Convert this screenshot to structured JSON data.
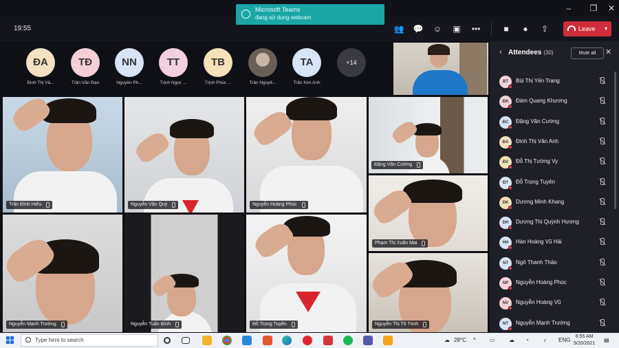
{
  "toast": {
    "title": "Microsoft Teams",
    "subtitle": "đang sử dụng webcam"
  },
  "meeting": {
    "time": "19:55",
    "leave_label": "Leave"
  },
  "avatar_row": [
    {
      "initials": "ĐA",
      "name": "Đinh Thị Vâ...",
      "color": "#f3e1c2"
    },
    {
      "initials": "TĐ",
      "name": "Trần Văn Đạo",
      "color": "#f4cfd6"
    },
    {
      "initials": "NN",
      "name": "Nguyễn Ph...",
      "color": "#d8e3f3"
    },
    {
      "initials": "TT",
      "name": "Trịnh Ngọc ...",
      "color": "#f4cfe0"
    },
    {
      "initials": "TB",
      "name": "Trịnh Phúc ...",
      "color": "#f4e2b8"
    },
    {
      "initials": "",
      "name": "Trần Nguyê...",
      "color": "#7a6f6a"
    },
    {
      "initials": "TA",
      "name": "Trần Kim Anh",
      "color": "#d6e4f5"
    }
  ],
  "more_count": "+14",
  "video_tiles": [
    {
      "name": "Trần Đình Hiếu"
    },
    {
      "name": "Nguyễn Văn Quý"
    },
    {
      "name": "Nguyễn Hoàng Phúc"
    },
    {
      "name": "Đặng Văn Cường"
    },
    {
      "name": "Phạm Thị Xuân Mai"
    },
    {
      "name": "Nguyễn Mạnh Trường"
    },
    {
      "name": "Nguyễn Tuấn Bình"
    },
    {
      "name": "Đỗ Trọng Tuyên"
    },
    {
      "name": "Nguyễn Thị Tô Trinh"
    }
  ],
  "attendees": {
    "title": "Attendees",
    "count": "(30)",
    "mute_all_label": "Mute all",
    "list": [
      {
        "initials": "BT",
        "name": "Bùi Thị Yến Trang",
        "color": "#f4d4dc"
      },
      {
        "initials": "ĐK",
        "name": "Đàm Quang Khương",
        "color": "#f4d0d8"
      },
      {
        "initials": "ĐC",
        "name": "Đặng Văn Cường",
        "color": "#d6e2f4"
      },
      {
        "initials": "ĐA",
        "name": "Đinh Thị Vân Anh",
        "color": "#f3e0c0"
      },
      {
        "initials": "ĐV",
        "name": "Đỗ Thị Tường Vy",
        "color": "#f1e3b4"
      },
      {
        "initials": "ĐT",
        "name": "Đỗ Trọng Tuyên",
        "color": "#d8e4f4"
      },
      {
        "initials": "DK",
        "name": "Dương Minh Khang",
        "color": "#f3dfb6"
      },
      {
        "initials": "DH",
        "name": "Dương Thị Quỳnh Hương",
        "color": "#d6e2f4"
      },
      {
        "initials": "HH",
        "name": "Hán Hoàng Vũ Hải",
        "color": "#d8e3f3"
      },
      {
        "initials": "NT",
        "name": "Ngô Thanh Thảo",
        "color": "#d8e3f3"
      },
      {
        "initials": "NP",
        "name": "Nguyễn Hoàng Phúc",
        "color": "#f4d4dc"
      },
      {
        "initials": "NV",
        "name": "Nguyễn Hoàng Vũ",
        "color": "#f4d0d8"
      },
      {
        "initials": "NT",
        "name": "Nguyễn Mạnh Trường",
        "color": "#d8e3f3"
      }
    ]
  },
  "taskbar": {
    "search_placeholder": "Type here to search",
    "weather": "28°C",
    "language": "ENG",
    "clock_time": "6:55 AM",
    "clock_date": "9/20/2021"
  }
}
